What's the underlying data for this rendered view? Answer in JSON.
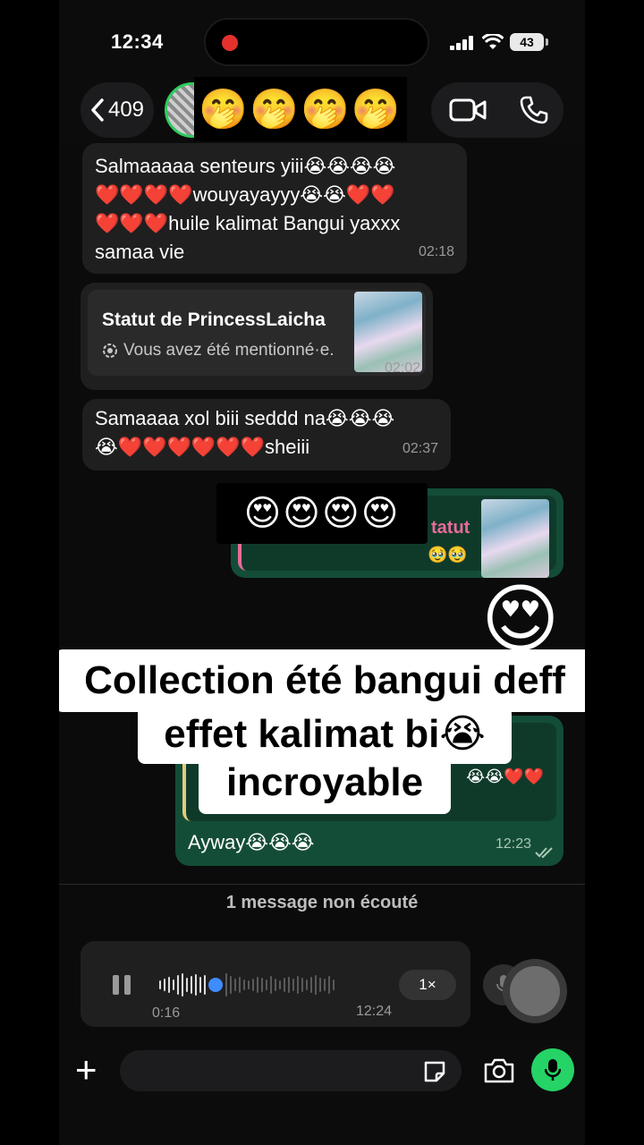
{
  "status_bar": {
    "time": "12:34",
    "battery": "43"
  },
  "header": {
    "back_count": "409",
    "name_cover_emoji": "🤭🤭🤭🤭"
  },
  "messages": [
    {
      "id": "b1",
      "direction": "in",
      "text": "Salmaaaaa senteurs yiii😭😭😭😭\n❤️❤️❤️❤️wouyayayyy😭😭❤️❤️\n❤️❤️❤️huile kalimat Bangui yaxxx\nsamaa vie",
      "time": "02:18"
    },
    {
      "id": "b2",
      "direction": "in",
      "status_title": "Statut de PrincessLaicha",
      "status_sub": "Vous avez été mentionné·e.",
      "time": "02:02"
    },
    {
      "id": "b3",
      "direction": "in",
      "text": "Samaaaa xol biii seddd na😭😭😭\n😭❤️❤️❤️❤️❤️❤️sheiii",
      "time": "02:37"
    },
    {
      "id": "b4",
      "direction": "out",
      "reply_label": "tatut",
      "reply_emoji": "🥹🥹",
      "cover_emoji": "😍😍😍😍"
    },
    {
      "id": "b4b",
      "direction": "out",
      "emoji": "😍"
    },
    {
      "id": "b5",
      "direction": "out",
      "reply_emoji": "😭😭❤️❤️",
      "text": "Ayway😭😭😭",
      "time": "12:23"
    }
  ],
  "caption": {
    "line1": "Collection été bangui deff",
    "line2": "effet kalimat bi😭",
    "line3": "incroyable"
  },
  "unread_label": "1 message non écouté",
  "voice_note": {
    "elapsed": "0:16",
    "time": "12:24",
    "speed": "1×"
  },
  "composer": {
    "placeholder": ""
  },
  "colors": {
    "accent": "#25d366",
    "outgoing": "#144d37",
    "incoming": "#1f1f1f",
    "mention": "#e86b9a",
    "playhead": "#3f8cff"
  }
}
